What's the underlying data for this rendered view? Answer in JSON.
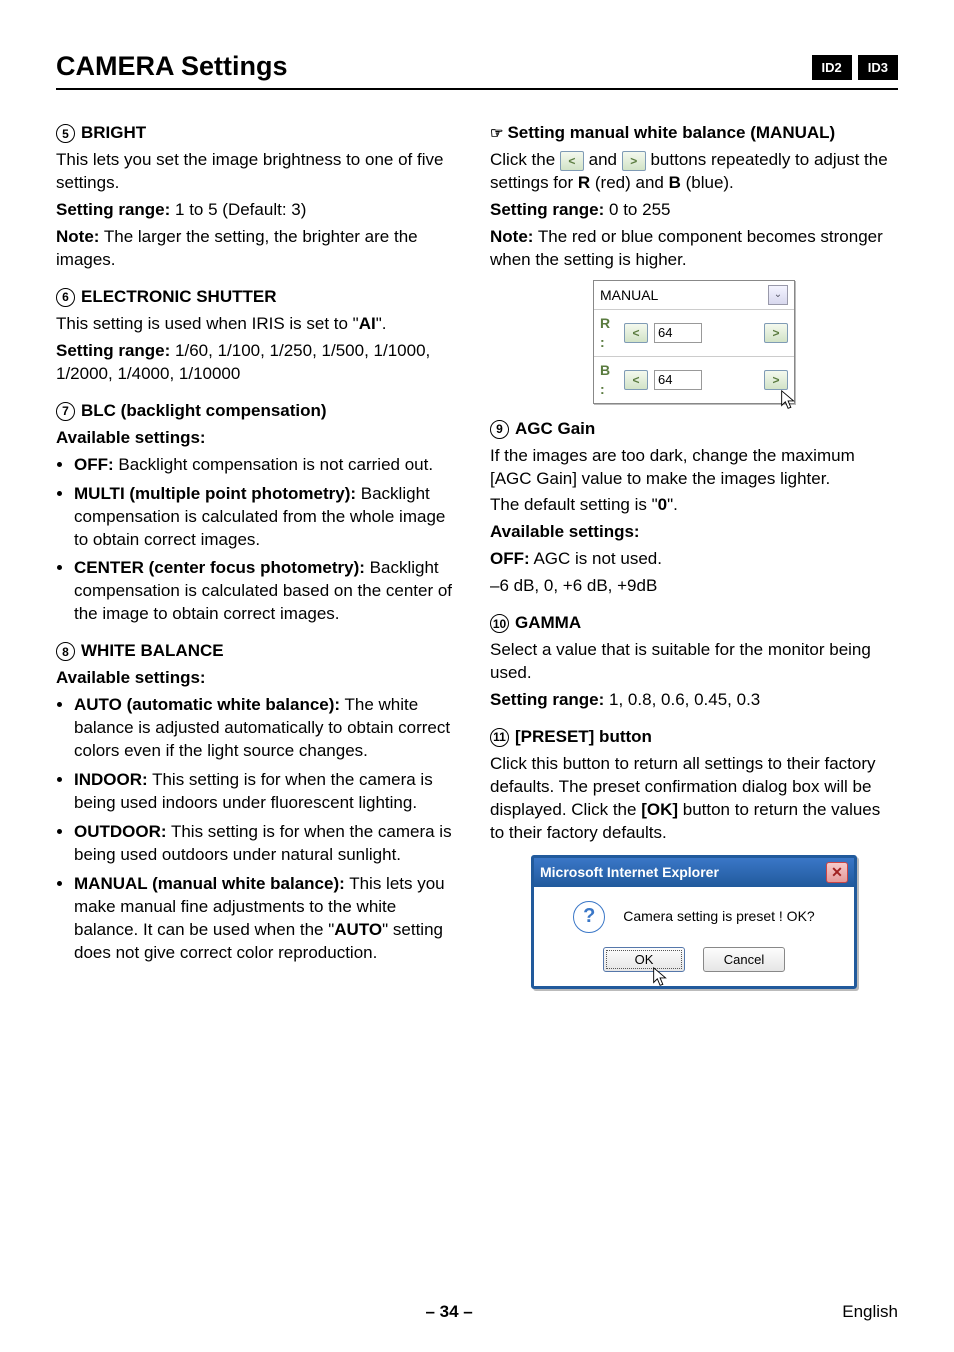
{
  "header": {
    "title": "CAMERA Settings",
    "badges": [
      "ID2",
      "ID3"
    ]
  },
  "left": {
    "bright": {
      "num": "5",
      "title": "BRIGHT",
      "intro": "This lets you set the image brightness to one of five settings.",
      "range_label": "Setting range:",
      "range": "1 to 5 (Default: 3)",
      "note_label": "Note:",
      "note": "The larger the setting, the brighter are the images."
    },
    "shutter": {
      "num": "6",
      "title": "ELECTRONIC SHUTTER",
      "intro_pre": "This setting is used when IRIS is set to \"",
      "intro_bold": "AI",
      "intro_post": "\".",
      "range_label": "Setting range:",
      "range": "1/60, 1/100, 1/250, 1/500, 1/1000, 1/2000, 1/4000, 1/10000"
    },
    "blc": {
      "num": "7",
      "title": "BLC (backlight compensation)",
      "avail": "Available settings:",
      "items": [
        {
          "name": "OFF:",
          "desc": "Backlight compensation is not carried out."
        },
        {
          "name": "MULTI (multiple point photometry):",
          "desc": "Backlight compensation is calculated from the whole image to obtain correct images."
        },
        {
          "name": "CENTER (center focus photometry):",
          "desc": "Backlight compensation is calculated based on the center of the image to obtain correct images."
        }
      ]
    },
    "wb": {
      "num": "8",
      "title": "WHITE BALANCE",
      "avail": "Available settings:",
      "items": [
        {
          "name": "AUTO (automatic white balance):",
          "desc": "The white balance is adjusted automatically to obtain correct colors even if the light source changes."
        },
        {
          "name": "INDOOR:",
          "desc": "This setting is for when the camera is being used indoors under fluorescent lighting."
        },
        {
          "name": "OUTDOOR:",
          "desc": "This setting is for when the camera is being used outdoors under natural sunlight."
        },
        {
          "name": "MANUAL (manual white balance):",
          "desc": "This lets you make manual fine adjustments to the white balance. It can be used when the \"AUTO\" setting does not give correct color reproduction.",
          "desc_pre": "This lets you make manual fine adjustments to the white balance. It can be used when the \"",
          "desc_bold": "AUTO",
          "desc_post": "\" setting does not give correct color reproduction."
        }
      ]
    }
  },
  "right": {
    "manual": {
      "hand": "☞",
      "title": "Setting manual white balance (MANUAL)",
      "line_pre": "Click the ",
      "line_mid": " and ",
      "line_post": " buttons repeatedly to adjust the settings for ",
      "r": "R",
      "r_desc": " (red) and ",
      "b": "B",
      "b_desc": " (blue).",
      "range_label": "Setting range:",
      "range": "0 to 255",
      "note_label": "Note:",
      "note": "The red or blue component becomes stronger when the setting is higher.",
      "ui": {
        "title": "MANUAL",
        "r_label": "R :",
        "b_label": "B :",
        "r_val": "64",
        "b_val": "64"
      }
    },
    "agc": {
      "num": "9",
      "title": "AGC Gain",
      "intro": "If the images are too dark, change the maximum [AGC Gain] value to make the images lighter.",
      "default_pre": "The default setting is \"",
      "default_bold": "0",
      "default_post": "\".",
      "avail": "Available settings:",
      "off_label": "OFF:",
      "off_desc": "AGC is not used.",
      "values": "–6 dB, 0, +6 dB, +9dB"
    },
    "gamma": {
      "num": "10",
      "title": "GAMMA",
      "intro": "Select a value that is suitable for the monitor being used.",
      "range_label": "Setting range:",
      "range": "1, 0.8, 0.6, 0.45, 0.3"
    },
    "preset": {
      "num": "11",
      "title": "[PRESET] button",
      "intro_pre": "Click this button to return all settings to their factory defaults. The preset confirmation dialog box will be displayed. Click the ",
      "intro_bold": "[OK]",
      "intro_post": " button to return the values to their factory defaults.",
      "dlg": {
        "title": "Microsoft Internet Explorer",
        "msg": "Camera setting is preset !  OK?",
        "ok": "OK",
        "cancel": "Cancel"
      }
    }
  },
  "footer": {
    "page": "– 34 –",
    "lang": "English"
  }
}
